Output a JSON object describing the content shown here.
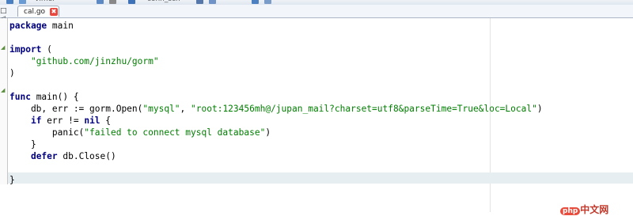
{
  "toolbar": {
    "partial_text_1": "vimer",
    "partial_text_2": "conn_sch"
  },
  "tabbar": {
    "control_label": "□ ◁",
    "active_tab": {
      "label": "cal.go",
      "close_glyph": "✖"
    }
  },
  "editor": {
    "lines": [
      {
        "segments": [
          {
            "kind": "kw",
            "text": "package"
          },
          {
            "kind": "plain",
            "text": " main"
          }
        ]
      },
      {
        "segments": [
          {
            "kind": "plain",
            "text": ""
          }
        ]
      },
      {
        "segments": [
          {
            "kind": "kw",
            "text": "import"
          },
          {
            "kind": "plain",
            "text": " ("
          }
        ]
      },
      {
        "segments": [
          {
            "kind": "plain",
            "text": "    "
          },
          {
            "kind": "str",
            "text": "\"github.com/jinzhu/gorm\""
          }
        ]
      },
      {
        "segments": [
          {
            "kind": "plain",
            "text": ")"
          }
        ]
      },
      {
        "segments": [
          {
            "kind": "plain",
            "text": ""
          }
        ]
      },
      {
        "segments": [
          {
            "kind": "kw",
            "text": "func"
          },
          {
            "kind": "plain",
            "text": " main() {"
          }
        ]
      },
      {
        "segments": [
          {
            "kind": "plain",
            "text": "    db, err := gorm.Open("
          },
          {
            "kind": "str",
            "text": "\"mysql\""
          },
          {
            "kind": "plain",
            "text": ", "
          },
          {
            "kind": "str",
            "text": "\"root:123456mh@/jupan_mail?charset=utf8&parseTime=True&loc=Local\""
          },
          {
            "kind": "plain",
            "text": ")"
          }
        ]
      },
      {
        "segments": [
          {
            "kind": "plain",
            "text": "    "
          },
          {
            "kind": "kw",
            "text": "if"
          },
          {
            "kind": "plain",
            "text": " err != "
          },
          {
            "kind": "kw",
            "text": "nil"
          },
          {
            "kind": "plain",
            "text": " {"
          }
        ]
      },
      {
        "segments": [
          {
            "kind": "plain",
            "text": "        panic("
          },
          {
            "kind": "str",
            "text": "\"failed to connect mysql database\""
          },
          {
            "kind": "plain",
            "text": ")"
          }
        ]
      },
      {
        "segments": [
          {
            "kind": "plain",
            "text": "    }"
          }
        ]
      },
      {
        "segments": [
          {
            "kind": "plain",
            "text": "    "
          },
          {
            "kind": "kw",
            "text": "defer"
          },
          {
            "kind": "plain",
            "text": " db.Close()"
          }
        ]
      },
      {
        "segments": [
          {
            "kind": "plain",
            "text": ""
          }
        ]
      },
      {
        "segments": [
          {
            "kind": "plain",
            "text": "}"
          }
        ]
      }
    ],
    "fold_markers": [
      "◢",
      "◢"
    ]
  },
  "watermark": {
    "badge": "php",
    "text": "中文网"
  },
  "colors": {
    "keyword": "#00007f",
    "string": "#007f00",
    "current_line": "#e6eef2",
    "tab_close": "#e8483f"
  }
}
